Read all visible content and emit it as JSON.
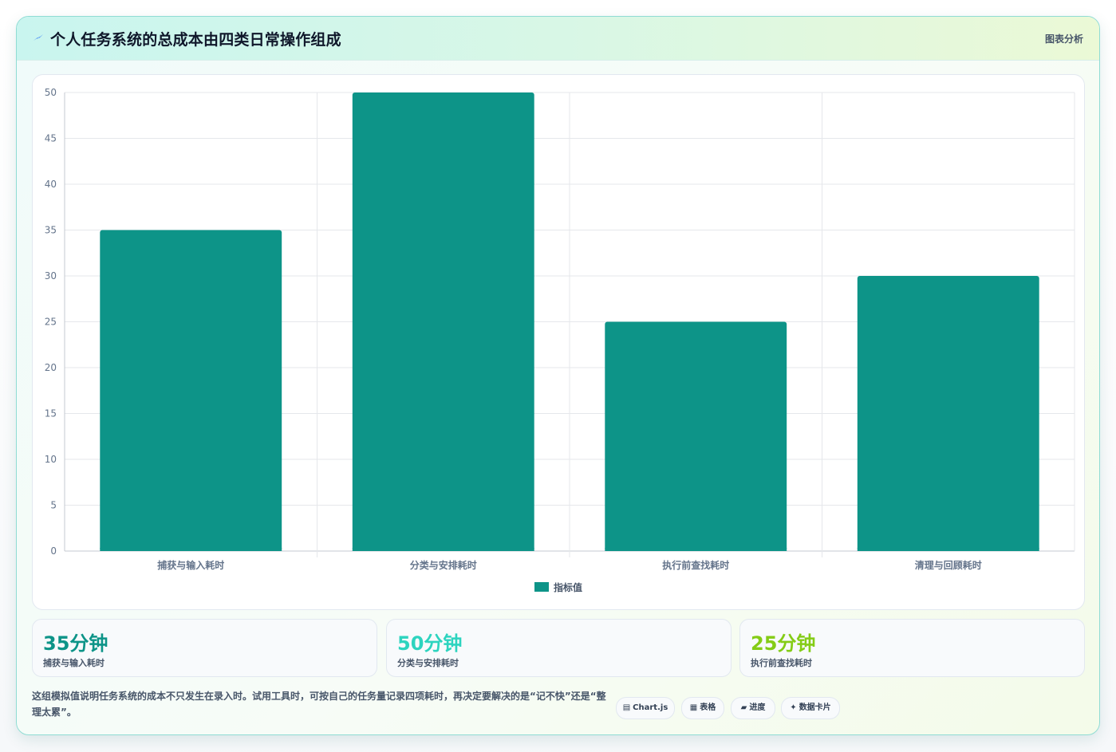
{
  "header": {
    "icon": "bolt-icon",
    "title": "个人任务系统的总成本由四类日常操作组成",
    "tag": "图表分析"
  },
  "chart_data": {
    "type": "bar",
    "categories": [
      "捕获与输入耗时",
      "分类与安排耗时",
      "执行前查找耗时",
      "清理与回顾耗时"
    ],
    "series": [
      {
        "name": "指标值",
        "values": [
          35,
          50,
          25,
          30
        ]
      }
    ],
    "ylim": [
      0,
      50
    ],
    "yticks": [
      0,
      5,
      10,
      15,
      20,
      25,
      30,
      35,
      40,
      45,
      50
    ],
    "grid": true,
    "legend": "bottom",
    "bar_color": "#0d9488"
  },
  "stats": [
    {
      "value": "35分钟",
      "label": "捕获与输入耗时",
      "color": "#0d9488"
    },
    {
      "value": "50分钟",
      "label": "分类与安排耗时",
      "color": "#2dd4bf"
    },
    {
      "value": "25分钟",
      "label": "执行前查找耗时",
      "color": "#84cc16"
    }
  ],
  "note": "这组模拟值说明任务系统的成本不只发生在录入时。试用工具时，可按自己的任务量记录四项耗时，再决定要解决的是“记不快”还是“整理太累”。",
  "tags": [
    {
      "icon": "chart-icon",
      "label": "Chart.js"
    },
    {
      "icon": "table-icon",
      "label": "表格"
    },
    {
      "icon": "progress-icon",
      "label": "进度"
    },
    {
      "icon": "sparkle-icon",
      "label": "数据卡片"
    }
  ]
}
